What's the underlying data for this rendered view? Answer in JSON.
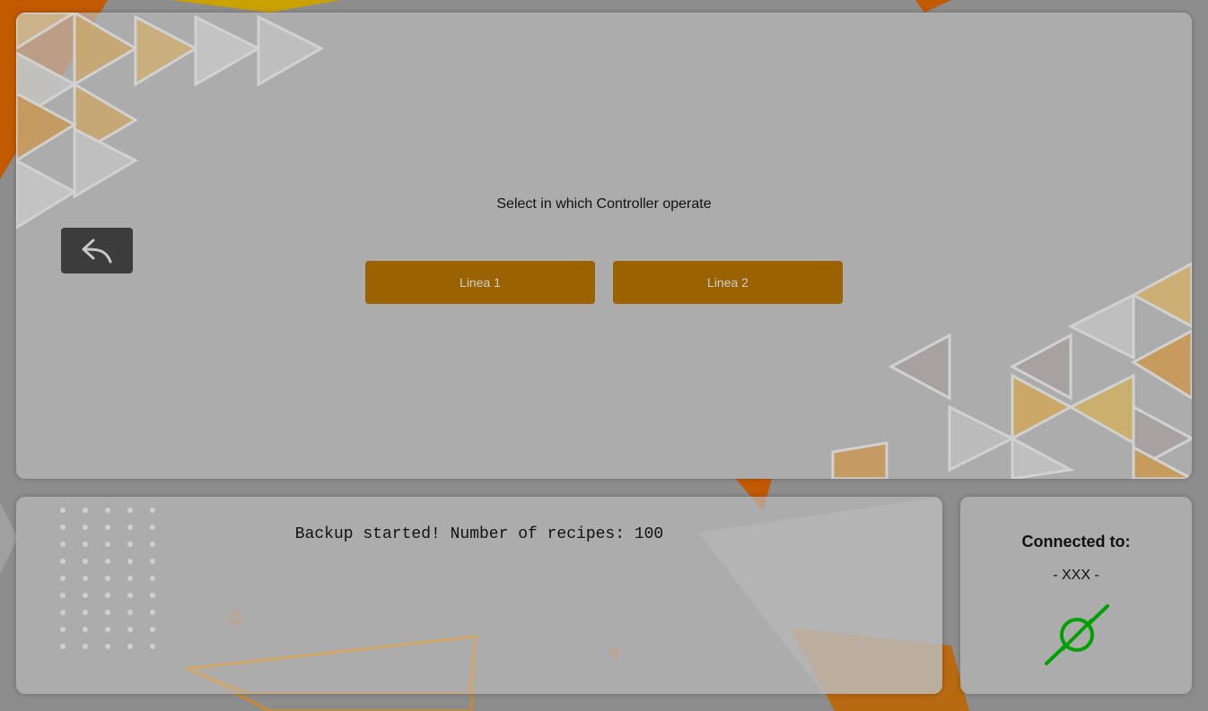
{
  "main": {
    "prompt": "Select in which Controller operate",
    "buttons": [
      {
        "label": "Linea 1"
      },
      {
        "label": "Linea 2"
      }
    ],
    "back_icon": "reply-arrow-icon"
  },
  "log": {
    "message": "Backup started! Number of recipes: 100"
  },
  "connection": {
    "title": "Connected to:",
    "value": "- XXX -",
    "icon": "plug-connected-icon",
    "icon_color": "#00a000"
  },
  "colors": {
    "accent": "#9a6200",
    "back_button": "#3c3c3c"
  }
}
